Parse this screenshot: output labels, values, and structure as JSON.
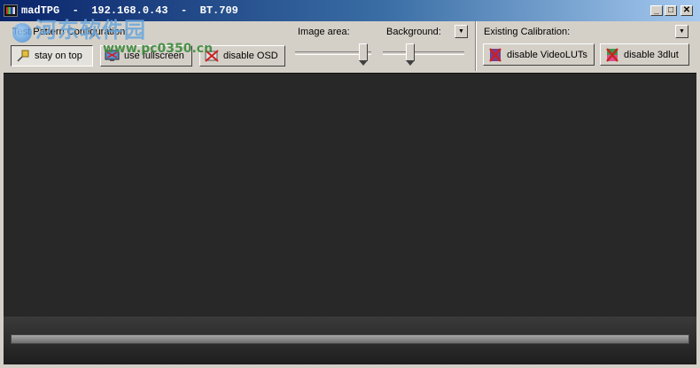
{
  "window": {
    "title": "madTPG  -  192.168.0.43  -  BT.709",
    "watermark_main": "河东软件园",
    "watermark_url": "www.pc0350.cn"
  },
  "toolbar": {
    "test_pattern_label": "Test Pattern Configuration:",
    "stay_on_top_label": "stay on top",
    "use_fullscreen_label": "use fullscreen",
    "disable_osd_label": "disable OSD",
    "image_area_label": "Image area:",
    "background_label": "Background:",
    "existing_calibration_label": "Existing Calibration:",
    "disable_videoluts_label": "disable VideoLUTs",
    "disable_3dlut_label": "disable 3dlut"
  },
  "sliders": {
    "image_area_level": 0.95,
    "background_level": 0.32
  },
  "icons": {
    "app": "madtpg-logo-icon",
    "stay_on_top": "pin-icon",
    "use_fullscreen": "monitor-icon",
    "disable_osd": "osd-disabled-icon",
    "disable_videoluts": "videolut-disabled-icon",
    "disable_3dlut": "3dlut-disabled-icon"
  },
  "colors": {
    "titlebar_start": "#0a246a",
    "titlebar_end": "#a6caf0",
    "pattern_background": "#282828",
    "disabled_x": "#cc1f1f"
  }
}
